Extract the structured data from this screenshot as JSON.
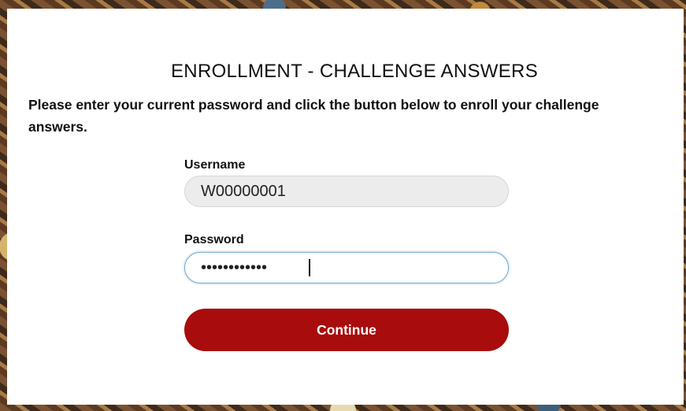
{
  "page": {
    "title": "ENROLLMENT - CHALLENGE ANSWERS",
    "intro": "Please enter your current password and click the button below to enroll your challenge answers."
  },
  "form": {
    "username_label": "Username",
    "username_value": "W00000001",
    "password_label": "Password",
    "password_value": "••••••••••••",
    "continue_label": "Continue"
  },
  "colors": {
    "accent": "#a80c0c",
    "focus_border": "#7aaed3",
    "disabled_field": "#ececec"
  }
}
